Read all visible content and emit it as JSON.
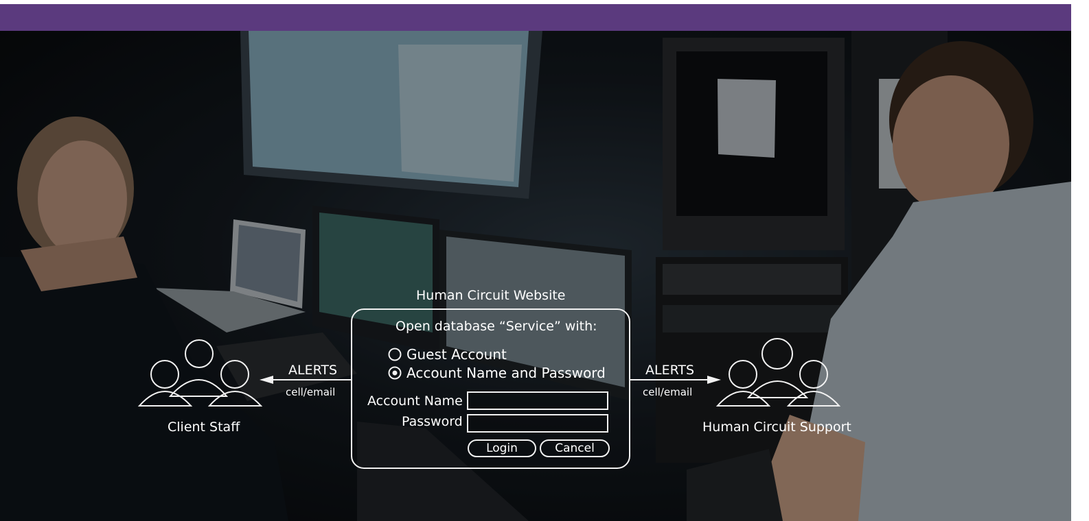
{
  "dialog": {
    "title": "Human Circuit Website",
    "prompt": "Open database “Service” with:",
    "options": [
      {
        "label": "Guest Account",
        "selected": false
      },
      {
        "label": "Account Name and Password",
        "selected": true
      }
    ],
    "account_name_label": "Account Name",
    "password_label": "Password",
    "login_label": "Login",
    "cancel_label": "Cancel"
  },
  "left": {
    "alerts_label": "ALERTS",
    "channel_label": "cell/email",
    "group_label": "Client Staff"
  },
  "right": {
    "alerts_label": "ALERTS",
    "channel_label": "cell/email",
    "group_label": "Human Circuit Support"
  },
  "colors": {
    "header_bar": "#5b3a7e",
    "overlay_line": "#f2f2f2"
  }
}
